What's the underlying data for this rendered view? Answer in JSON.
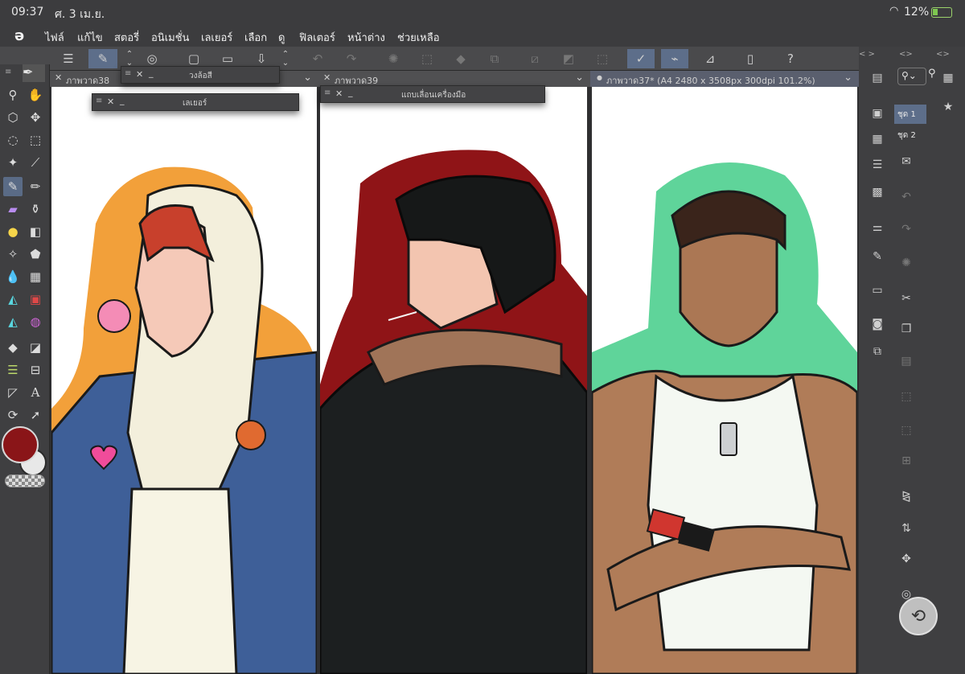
{
  "status_bar": {
    "time": "09:37",
    "date": "ศ. 3 เม.ย.",
    "battery": "12%"
  },
  "menu": {
    "items": [
      "ไฟล์",
      "แก้ไข",
      "สตอรี่",
      "อนิเมชั่น",
      "เลเยอร์",
      "เลือก",
      "ดู",
      "ฟิลเตอร์",
      "หน้าต่าง",
      "ช่วยเหลือ"
    ]
  },
  "command_bar": {
    "icons": [
      "menu-icon",
      "new-canvas-icon",
      "stepper-icon",
      "companion-icon",
      "new-file-icon",
      "open-folder-icon",
      "save-icon",
      "stepper-icon",
      "undo-icon",
      "redo-icon",
      "loading-icon",
      "select-all-icon",
      "fill-icon",
      "transform-icon",
      "deselect-icon",
      "invert-icon",
      "crop-icon",
      "pen-pressure-icon",
      "brush-icon",
      "ruler-icon",
      "device-icon",
      "help-icon"
    ]
  },
  "panels": {
    "color_wheel": "วงล้อสี",
    "layer": "เลเยอร์",
    "tool_tray": "แถบเลื่อนเครื่องมือ"
  },
  "canvases": [
    {
      "tab_title": "ภาพวาด38",
      "outline_color": "#f2a03a",
      "bg_note": ""
    },
    {
      "tab_title": "ภาพวาด39",
      "outline_color": "#8f1417",
      "bg_note": ""
    },
    {
      "tab_title": "ภาพวาด37* (A4 2480 x 3508px 300dpi 101.2%)",
      "outline_color": "#5fd49a",
      "bg_note": ""
    }
  ],
  "tools": {
    "icons": [
      "zoom-icon",
      "hand-icon",
      "move-3d-icon",
      "move-icon",
      "lasso-icon",
      "rect-select-icon",
      "magic-wand-icon",
      "eyedropper-icon",
      "pen-icon",
      "pencil-icon",
      "marker-icon",
      "airbrush-icon",
      "brush-icon",
      "eraser-icon",
      "decoration-icon",
      "blend-icon",
      "fill-icon",
      "gradient-icon",
      "figure-icon",
      "frame-icon",
      "text-icon",
      "balloon-icon",
      "ruler-icon",
      "operation-icon"
    ],
    "main_color": "#8a1518",
    "sub_color": "#e8e8e8"
  },
  "right_dock": {
    "sets": [
      "ชุด 1",
      "ชุด 2"
    ]
  }
}
